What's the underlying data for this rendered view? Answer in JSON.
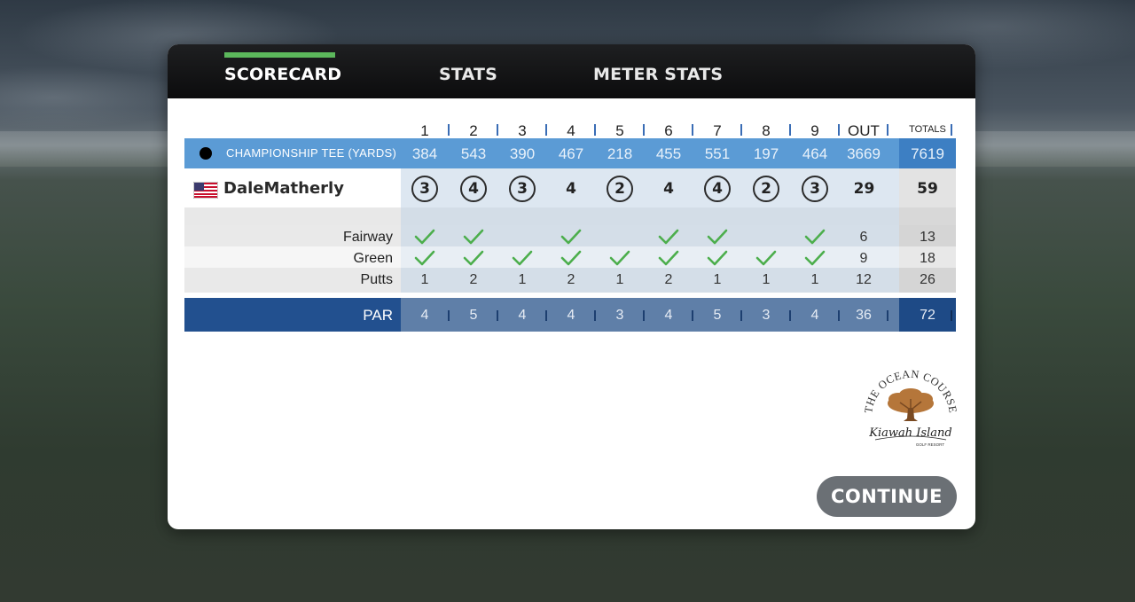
{
  "tabs": [
    {
      "label": "SCORECARD",
      "active": true
    },
    {
      "label": "STATS",
      "active": false
    },
    {
      "label": "METER STATS",
      "active": false
    }
  ],
  "scorecard": {
    "columns": [
      "1",
      "2",
      "3",
      "4",
      "5",
      "6",
      "7",
      "8",
      "9",
      "OUT"
    ],
    "totals_label": "TOTALS",
    "tee": {
      "label": "CHAMPIONSHIP TEE (YARDS)",
      "values": [
        "384",
        "543",
        "390",
        "467",
        "218",
        "455",
        "551",
        "197",
        "464",
        "3669"
      ],
      "total": "7619"
    },
    "player": {
      "name": "DaleMatherly",
      "flag": "us-flag-icon",
      "scores": [
        {
          "value": "3",
          "circled": true
        },
        {
          "value": "4",
          "circled": true
        },
        {
          "value": "3",
          "circled": true
        },
        {
          "value": "4",
          "circled": false
        },
        {
          "value": "2",
          "circled": true
        },
        {
          "value": "4",
          "circled": false
        },
        {
          "value": "4",
          "circled": true
        },
        {
          "value": "2",
          "circled": true
        },
        {
          "value": "3",
          "circled": true
        }
      ],
      "out": "29",
      "total": "59"
    },
    "fairway": {
      "label": "Fairway",
      "hits": [
        true,
        true,
        false,
        true,
        false,
        true,
        true,
        false,
        true
      ],
      "out": "6",
      "total": "13"
    },
    "green": {
      "label": "Green",
      "hits": [
        true,
        true,
        true,
        true,
        true,
        true,
        true,
        true,
        true
      ],
      "out": "9",
      "total": "18"
    },
    "putts": {
      "label": "Putts",
      "values": [
        "1",
        "2",
        "1",
        "2",
        "1",
        "2",
        "1",
        "1",
        "1"
      ],
      "out": "12",
      "total": "26"
    },
    "par": {
      "label": "PAR",
      "values": [
        "4",
        "5",
        "4",
        "4",
        "3",
        "4",
        "5",
        "3",
        "4"
      ],
      "out": "36",
      "total": "72"
    }
  },
  "logo": {
    "top_text": "THE OCEAN COURSE",
    "script_text": "Kiawah Island",
    "small_text": "GOLF RESORT"
  },
  "continue_label": "CONTINUE",
  "colors": {
    "accent_green": "#5cb85c",
    "tee_blue": "#5b9bd5",
    "par_blue": "#22508f",
    "check_green": "#4cae4c"
  }
}
